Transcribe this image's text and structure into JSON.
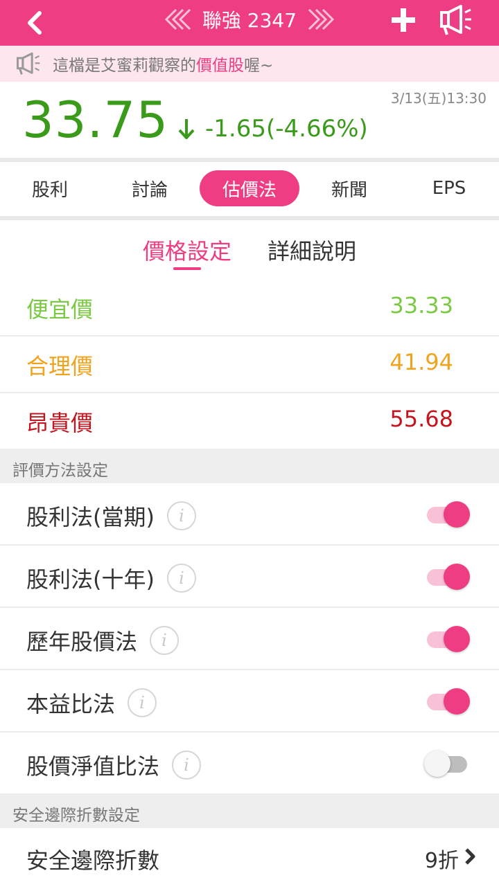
{
  "header": {
    "title": "聯強 2347"
  },
  "banner": {
    "text_before": "這檔是艾蜜莉觀察的",
    "highlight": "價值股",
    "text_after": "喔~"
  },
  "quote": {
    "price": "33.75",
    "change": "-1.65(-4.66%)",
    "datetime": "3/13(五)13:30",
    "color": "#3a9a1a"
  },
  "tabs": [
    {
      "label": "股利",
      "active": false
    },
    {
      "label": "討論",
      "active": false
    },
    {
      "label": "估價法",
      "active": true
    },
    {
      "label": "新聞",
      "active": false
    },
    {
      "label": "EPS",
      "active": false
    }
  ],
  "subtabs": [
    {
      "label": "價格設定",
      "active": true
    },
    {
      "label": "詳細說明",
      "active": false
    }
  ],
  "prices": [
    {
      "label": "便宜價",
      "value": "33.33",
      "color": "#7ac943"
    },
    {
      "label": "合理價",
      "value": "41.94",
      "color": "#f0a31e"
    },
    {
      "label": "昂貴價",
      "value": "55.68",
      "color": "#c4141d"
    }
  ],
  "methods_section": "評價方法設定",
  "methods": [
    {
      "label": "股利法(當期)",
      "enabled": true
    },
    {
      "label": "股利法(十年)",
      "enabled": true
    },
    {
      "label": "歷年股價法",
      "enabled": true
    },
    {
      "label": "本益比法",
      "enabled": true
    },
    {
      "label": "股價淨值比法",
      "enabled": false
    }
  ],
  "safety_section": "安全邊際折數設定",
  "safety": {
    "label": "安全邊際折數",
    "value": "9折"
  },
  "colors": {
    "accent": "#ee3d82",
    "banner_bg": "#fde6ed"
  }
}
